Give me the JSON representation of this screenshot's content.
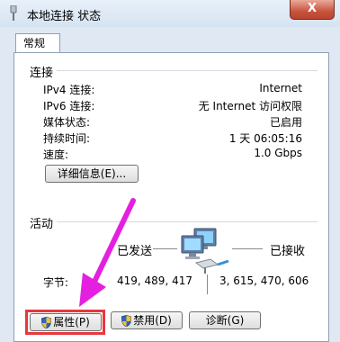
{
  "window": {
    "title": "本地连接 状态",
    "close_label": "X"
  },
  "tab": {
    "label": "常规"
  },
  "connection": {
    "group_title": "连接",
    "rows": [
      {
        "label": "IPv4 连接:",
        "value": "Internet"
      },
      {
        "label": "IPv6 连接:",
        "value": "无 Internet 访问权限"
      },
      {
        "label": "媒体状态:",
        "value": "已启用"
      },
      {
        "label": "持续时间:",
        "value": "1 天 06:05:16"
      },
      {
        "label": "速度:",
        "value": "1.0 Gbps"
      }
    ],
    "details_button": "详细信息(E)..."
  },
  "activity": {
    "group_title": "活动",
    "sent_label": "已发送",
    "received_label": "已接收",
    "bytes_label": "字节:",
    "bytes_sent": "419, 489, 417",
    "bytes_received": "3, 615, 470, 606"
  },
  "buttons": {
    "properties": "属性(P)",
    "disable": "禁用(D)",
    "diagnose": "诊断(G)"
  }
}
